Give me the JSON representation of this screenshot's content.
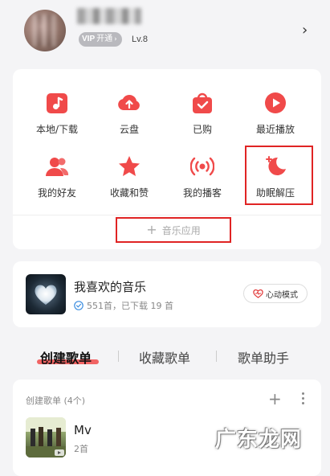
{
  "profile": {
    "vip_badge_mark": "VIP",
    "vip_badge_label": "开通",
    "level": "Lv.8"
  },
  "grid": {
    "row1": [
      {
        "label": "本地/下载",
        "icon": "local-download-icon"
      },
      {
        "label": "云盘",
        "icon": "cloud-upload-icon"
      },
      {
        "label": "已购",
        "icon": "purchased-bag-icon"
      },
      {
        "label": "最近播放",
        "icon": "recent-play-icon"
      }
    ],
    "row2": [
      {
        "label": "我的好友",
        "icon": "friends-icon"
      },
      {
        "label": "收藏和赞",
        "icon": "star-icon"
      },
      {
        "label": "我的播客",
        "icon": "podcast-icon"
      },
      {
        "label": "助眠解压",
        "icon": "moon-sleep-icon"
      }
    ],
    "add_app_label": "音乐应用"
  },
  "favorite": {
    "title": "我喜欢的音乐",
    "stats": "551首，已下载 19 首",
    "mode_button": "心动模式"
  },
  "tabs": {
    "created": "创建歌单",
    "collected": "收藏歌单",
    "assistant": "歌单助手"
  },
  "playlists": {
    "header": "创建歌单 (4个)",
    "items": [
      {
        "name": "Mv",
        "count": "2首"
      }
    ]
  },
  "watermark": "广东龙网",
  "colors": {
    "accent": "#f04a4a",
    "highlight_border": "#e02424",
    "background": "#f4f4f6"
  }
}
